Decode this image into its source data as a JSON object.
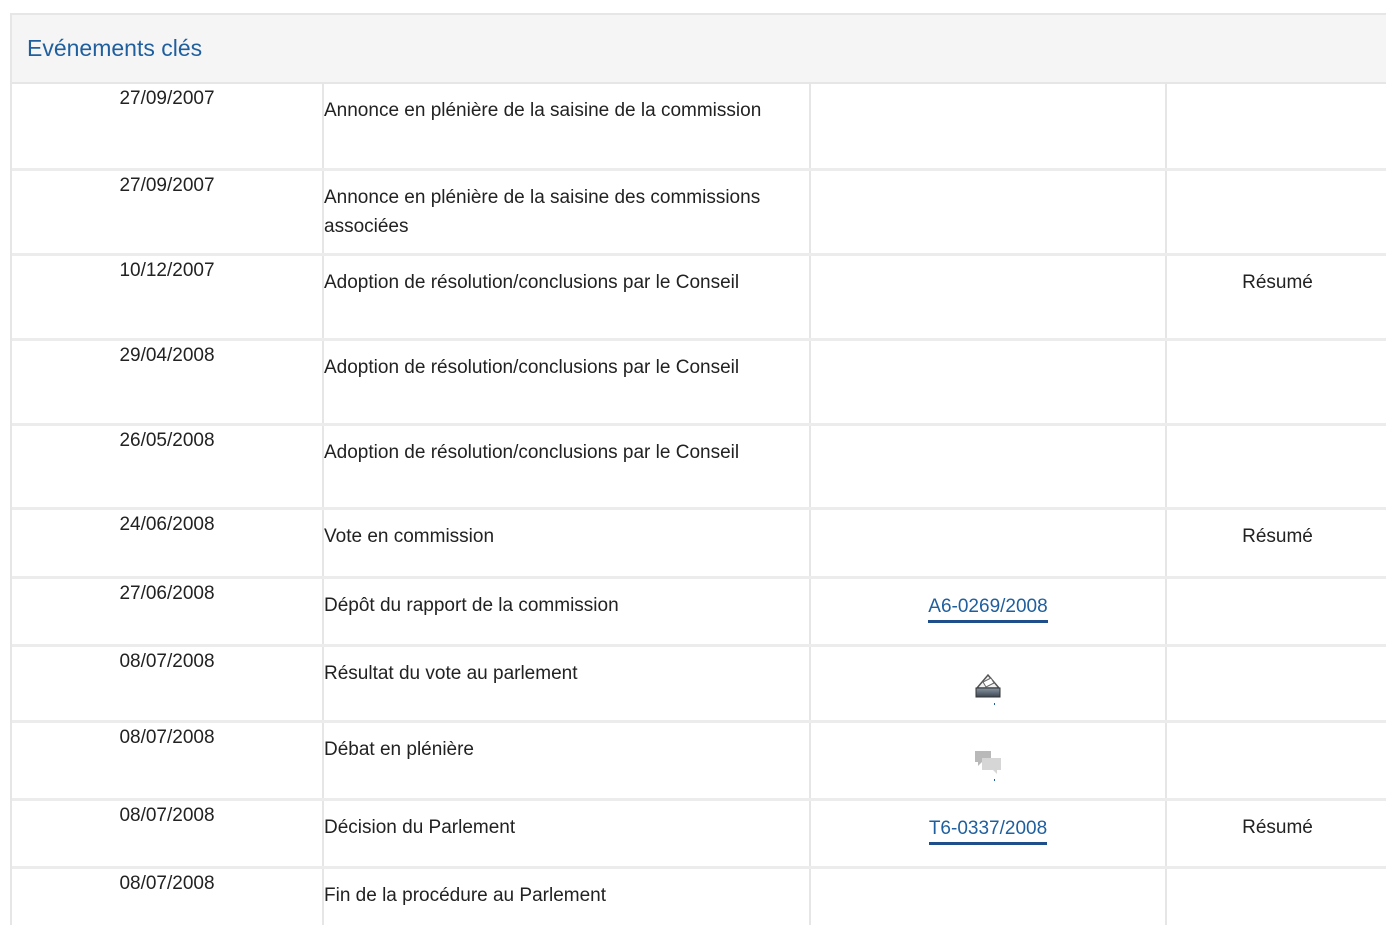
{
  "panel": {
    "title": "Evénements clés"
  },
  "colors": {
    "title": "#1f5f9e",
    "link": "#1f5f9e",
    "header_bg": "#f5f5f5",
    "border": "#e6e6e6"
  },
  "rows": [
    {
      "date": "27/09/2007",
      "event": "Annonce en plénière de la saisine de la commission",
      "ref": "",
      "summary": ""
    },
    {
      "date": "27/09/2007",
      "event": "Annonce en plénière de la saisine des commissions associées",
      "ref": "",
      "summary": ""
    },
    {
      "date": "10/12/2007",
      "event": "Adoption de résolution/conclusions par le Conseil",
      "ref": "",
      "summary": "Résumé"
    },
    {
      "date": "29/04/2008",
      "event": "Adoption de résolution/conclusions par le Conseil",
      "ref": "",
      "summary": ""
    },
    {
      "date": "26/05/2008",
      "event": "Adoption de résolution/conclusions par le Conseil",
      "ref": "",
      "summary": ""
    },
    {
      "date": "24/06/2008",
      "event": "Vote en commission",
      "ref": "",
      "summary": "Résumé"
    },
    {
      "date": "27/06/2008",
      "event": "Dépôt du rapport de la commission",
      "ref": "A6-0269/2008",
      "summary": ""
    },
    {
      "date": "08/07/2008",
      "event": "Résultat du vote au parlement",
      "ref_icon": "ballot-box-icon",
      "summary": ""
    },
    {
      "date": "08/07/2008",
      "event": "Débat en plénière",
      "ref_icon": "debate-speech-bubbles-icon",
      "summary": ""
    },
    {
      "date": "08/07/2008",
      "event": "Décision du Parlement",
      "ref": "T6-0337/2008",
      "summary": "Résumé"
    },
    {
      "date": "08/07/2008",
      "event": "Fin de la procédure au Parlement",
      "ref": "",
      "summary": ""
    }
  ]
}
